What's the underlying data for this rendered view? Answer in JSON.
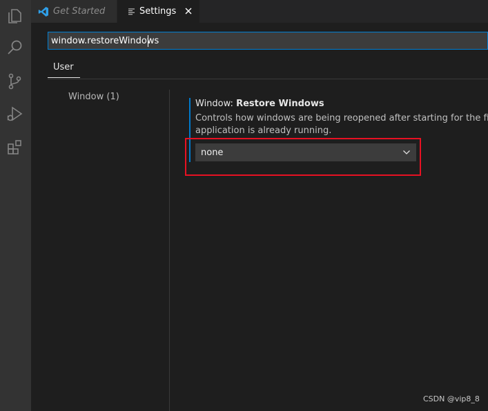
{
  "activity_bar": {
    "icons": [
      "explorer-icon",
      "search-icon",
      "source-control-icon",
      "run-debug-icon",
      "extensions-icon"
    ]
  },
  "tabs": [
    {
      "label": "Get Started",
      "icon": "vscode-logo-icon",
      "active": false
    },
    {
      "label": "Settings",
      "icon": "settings-lines-icon",
      "active": true,
      "close": "×"
    }
  ],
  "search": {
    "value": "window.restoreWindows"
  },
  "scope": {
    "user_label": "User"
  },
  "toc": {
    "items": [
      {
        "label": "Window (1)"
      }
    ]
  },
  "setting": {
    "category": "Window: ",
    "name": "Restore Windows",
    "description_lines": [
      "Controls how windows are being reopened after starting for the first time.",
      "application is already running."
    ],
    "value": "none"
  },
  "watermark": "CSDN @vip8_8",
  "colors": {
    "accent": "#007acc",
    "focus_border": "#007fd4",
    "highlight_box": "#e81123",
    "activity_bar_bg": "#333333",
    "editor_bg": "#1e1e1e"
  }
}
